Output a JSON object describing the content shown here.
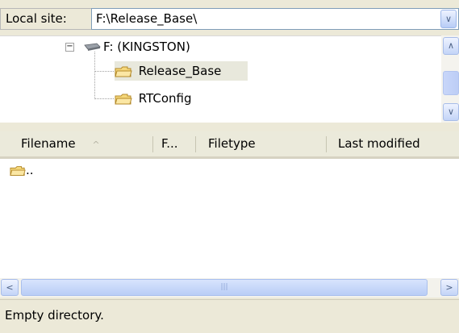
{
  "local_site": {
    "label": "Local site:",
    "path": "F:\\Release_Base\\"
  },
  "tree": {
    "drive": "F: (KINGSTON)",
    "folders": [
      "Release_Base",
      "RTConfig"
    ],
    "selected": "Release_Base"
  },
  "file_list": {
    "columns": [
      "Filename",
      "F...",
      "Filetype",
      "Last modified"
    ],
    "sort_indicator": "^",
    "items": [
      ".."
    ]
  },
  "status": {
    "text": "Empty directory."
  },
  "icons": {
    "expander": "minus-box-icon",
    "drive": "drive-icon",
    "folder": "folder-icon",
    "scroll_up": "chevron-up-icon",
    "scroll_down": "chevron-down-icon",
    "scroll_left": "chevron-left-icon",
    "scroll_right": "chevron-right-icon"
  },
  "colors": {
    "scroll_accent": "#c3d4f7",
    "folder": "#f5d77a",
    "selection": "#e8e8dc"
  }
}
